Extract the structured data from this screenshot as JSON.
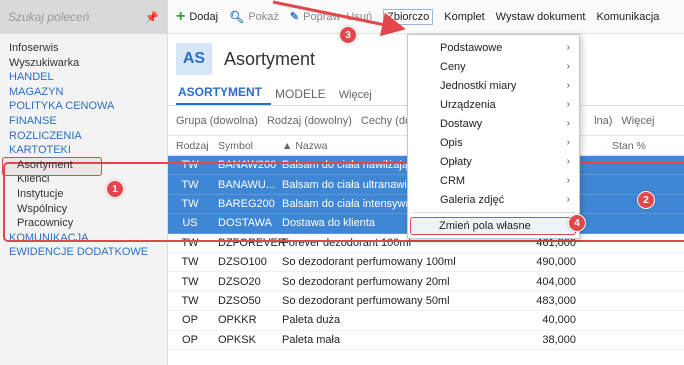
{
  "sidebar": {
    "search_placeholder": "Szukaj poleceń",
    "pin_icon": "pin-icon",
    "items": [
      {
        "label": "Infoserwis",
        "kind": "link"
      },
      {
        "label": "Wyszukiwarka",
        "kind": "link"
      },
      {
        "label": "HANDEL",
        "kind": "cat"
      },
      {
        "label": "MAGAZYN",
        "kind": "cat"
      },
      {
        "label": "POLITYKA CENOWA",
        "kind": "cat"
      },
      {
        "label": "FINANSE",
        "kind": "cat"
      },
      {
        "label": "ROZLICZENIA",
        "kind": "cat"
      },
      {
        "label": "KARTOTEKI",
        "kind": "cat"
      },
      {
        "label": "Asortyment",
        "kind": "sub"
      },
      {
        "label": "Klienci",
        "kind": "sub"
      },
      {
        "label": "Instytucje",
        "kind": "sub"
      },
      {
        "label": "Wspólnicy",
        "kind": "sub"
      },
      {
        "label": "Pracownicy",
        "kind": "sub"
      },
      {
        "label": "KOMUNIKACJA",
        "kind": "cat"
      },
      {
        "label": "EWIDENCJE DODATKOWE",
        "kind": "cat"
      }
    ]
  },
  "toolbar": {
    "add": "Dodaj",
    "show": "Pokaż",
    "edit": "Popraw",
    "delete": "Usuń",
    "bulk": "Zbiorczo",
    "kit": "Komplet",
    "issue_doc": "Wystaw dokument",
    "communication": "Komunikacja"
  },
  "page": {
    "avatar": "AS",
    "title": "Asortyment"
  },
  "tabs": [
    "ASORTYMENT",
    "MODELE",
    "Więcej"
  ],
  "filters": {
    "group": "Grupa (dowolna)",
    "type": "Rodzaj (dowolny)",
    "features": "Cechy (do",
    "right_suffix": "lna)",
    "more": "Więcej"
  },
  "table": {
    "headers": {
      "rodzaj": "Rodzaj",
      "symbol": "Symbol",
      "nazwa": "Nazwa",
      "stan": "Stan %"
    },
    "sort_icon": "sort-up-icon",
    "rows": [
      {
        "rodzaj": "TW",
        "symbol": "BANAW200",
        "nazwa": "Balsam do ciała nawilżający",
        "value": "",
        "selected": true
      },
      {
        "rodzaj": "TW",
        "symbol": "BANAWU...",
        "nazwa": "Balsam do ciała ultranawilż",
        "value": "",
        "selected": true
      },
      {
        "rodzaj": "TW",
        "symbol": "BAREG200",
        "nazwa": "Balsam do ciała intensywni",
        "value": "",
        "selected": true
      },
      {
        "rodzaj": "US",
        "symbol": "DOSTAWA",
        "nazwa": "Dostawa do klienta",
        "value": "",
        "selected": true
      },
      {
        "rodzaj": "TW",
        "symbol": "DZFOREVER",
        "nazwa": "Forever dezodorant 100ml",
        "value": "461,000",
        "selected": false
      },
      {
        "rodzaj": "TW",
        "symbol": "DZSO100",
        "nazwa": "So dezodorant perfumowany 100ml",
        "value": "490,000",
        "selected": false
      },
      {
        "rodzaj": "TW",
        "symbol": "DZSO20",
        "nazwa": "So dezodorant perfumowany 20ml",
        "value": "404,000",
        "selected": false
      },
      {
        "rodzaj": "TW",
        "symbol": "DZSO50",
        "nazwa": "So dezodorant perfumowany 50ml",
        "value": "483,000",
        "selected": false
      },
      {
        "rodzaj": "OP",
        "symbol": "OPKKR",
        "nazwa": "Paleta duża",
        "value": "40,000",
        "selected": false
      },
      {
        "rodzaj": "OP",
        "symbol": "OPKSK",
        "nazwa": "Paleta mała",
        "value": "38,000",
        "selected": false
      }
    ]
  },
  "menu": {
    "items": [
      {
        "label": "Podstawowe",
        "submenu": true
      },
      {
        "label": "Ceny",
        "submenu": true
      },
      {
        "label": "Jednostki miary",
        "submenu": true
      },
      {
        "label": "Urządzenia",
        "submenu": true
      },
      {
        "label": "Dostawy",
        "submenu": true
      },
      {
        "label": "Opis",
        "submenu": true
      },
      {
        "label": "Opłaty",
        "submenu": true
      },
      {
        "label": "CRM",
        "submenu": true
      },
      {
        "label": "Galeria zdjęć",
        "submenu": true
      }
    ],
    "highlighted": "Zmień pola własne"
  },
  "badges": [
    "1",
    "2",
    "3",
    "4"
  ],
  "colors": {
    "accent": "#2a6fc4",
    "annotation": "#e2474c",
    "selection": "#3f87d4"
  }
}
